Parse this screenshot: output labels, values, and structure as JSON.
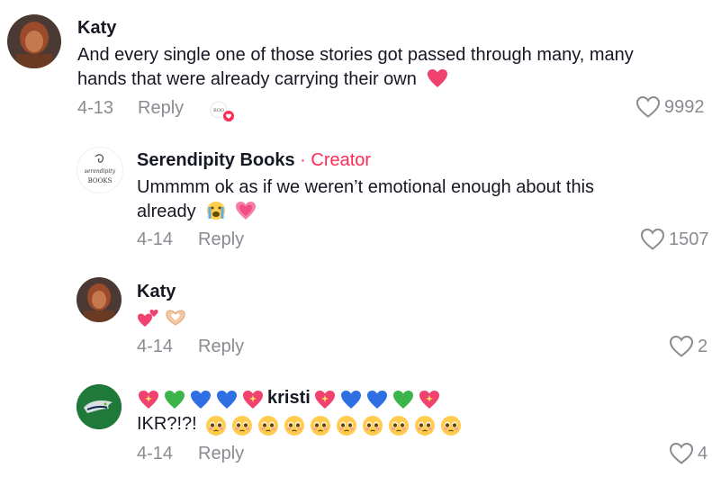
{
  "comments": [
    {
      "username": "Katy",
      "text": "And every single one of those stories got passed through many, many hands that were already carrying their own",
      "text_line1": "And every single one of those stories got passed through many, many",
      "text_line2": "hands that were already carrying their own",
      "emoji": "❤️",
      "date": "4-13",
      "reply_label": "Reply",
      "likes": "9992",
      "creator_liked": true
    },
    {
      "username": "Serendipity Books",
      "creator_separator": " · ",
      "creator_label": "Creator",
      "text_line1": "Ummmm ok as if we weren’t emotional enough about this",
      "text_line2": "already",
      "emoji": "😭 💗",
      "date": "4-14",
      "reply_label": "Reply",
      "likes": "1507",
      "avatar_text": "BOOKS"
    },
    {
      "username": "Katy",
      "text": "💕🫶",
      "date": "4-14",
      "reply_label": "Reply",
      "likes": "2"
    },
    {
      "username_prefix": "💖💚💙💙💖",
      "username": "kristi",
      "username_suffix": "💖💙💙💚💖",
      "text": "IKR?!?!",
      "emoji_row": "🥹🥹🥹🥹🥹🥹🥹🥹🥹🥹",
      "date": "4-14",
      "reply_label": "Reply",
      "likes": "4"
    }
  ],
  "colors": {
    "primary_text": "#161823",
    "secondary_text": "#8a8b91",
    "creator_red": "#fe2c55",
    "heart_pink": "#fe2c55"
  }
}
